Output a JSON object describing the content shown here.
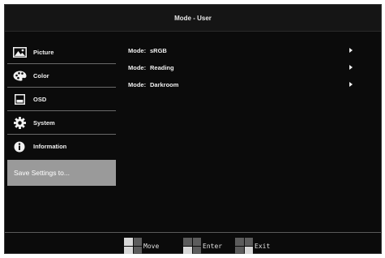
{
  "window": {
    "title": "Mode - User"
  },
  "sidebar": {
    "items": [
      {
        "label": "Picture",
        "icon": "picture-icon"
      },
      {
        "label": "Color",
        "icon": "palette-icon"
      },
      {
        "label": "OSD",
        "icon": "osd-window-icon"
      },
      {
        "label": "System",
        "icon": "gear-icon"
      },
      {
        "label": "Information",
        "icon": "info-icon"
      }
    ],
    "save_label": "Save Settings to..."
  },
  "modes": [
    {
      "prefix": "Mode:",
      "value": "sRGB"
    },
    {
      "prefix": "Mode:",
      "value": "Reading"
    },
    {
      "prefix": "Mode:",
      "value": "Darkroom"
    }
  ],
  "footer": {
    "move": "Move",
    "enter": "Enter",
    "exit": "Exit"
  },
  "colors": {
    "background": "#0b0b0b",
    "selected": "#9a9a9a",
    "text": "#f0f0f0"
  }
}
